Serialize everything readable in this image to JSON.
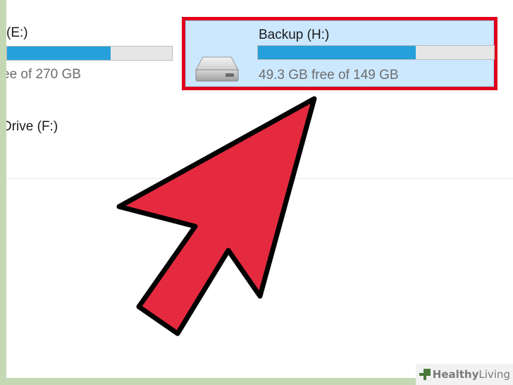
{
  "drives": {
    "e": {
      "label": "(E:)",
      "free_text": "ee of 270 GB",
      "used_fraction": 0.63
    },
    "f": {
      "label": "Drive (F:)"
    },
    "h": {
      "label": "Backup (H:)",
      "free_text": "49.3 GB free of 149 GB",
      "used_fraction": 0.67,
      "selected": true
    }
  },
  "annotation": {
    "arrow_color": "#e52a3f",
    "highlight_color": "#e0001b"
  },
  "watermark": {
    "brand_bold": "Healthy",
    "brand_light": "Living"
  },
  "icons": {
    "drive": "hard-drive-icon",
    "watermark": "healthy-living-logo-icon"
  }
}
